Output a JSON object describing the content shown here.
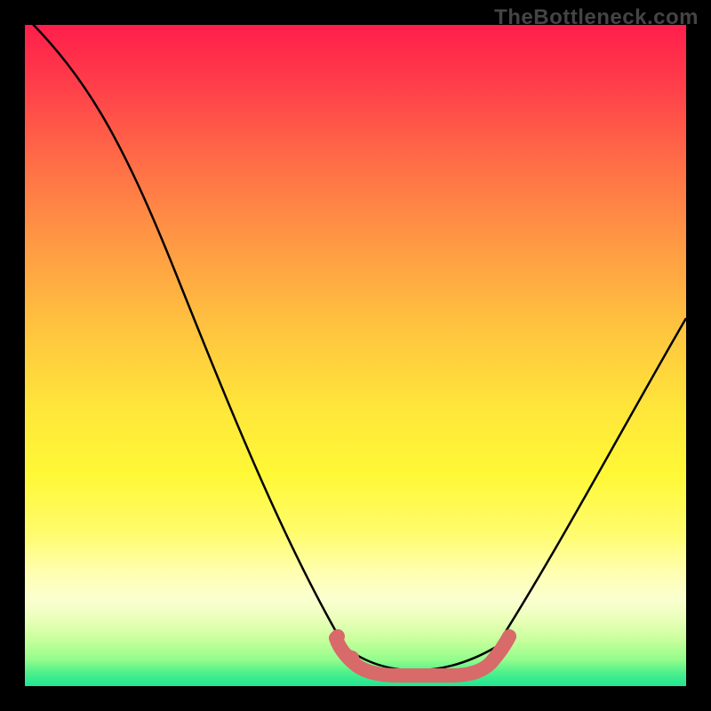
{
  "watermark": "TheBottleneck.com",
  "chart_data": {
    "type": "line",
    "title": "",
    "xlabel": "",
    "ylabel": "",
    "xlim": [
      0,
      100
    ],
    "ylim": [
      0,
      100
    ],
    "series": [
      {
        "name": "bottleneck-curve",
        "x": [
          0,
          5,
          10,
          15,
          20,
          25,
          30,
          35,
          40,
          45,
          50,
          55,
          60,
          65,
          70,
          75,
          80,
          85,
          90,
          95,
          100
        ],
        "values": [
          102,
          99,
          94,
          85,
          75,
          63,
          50,
          37,
          24,
          12,
          4,
          1,
          0,
          1,
          3,
          8,
          16,
          27,
          38,
          48,
          56
        ]
      },
      {
        "name": "optimal-zone-band",
        "x": [
          47,
          49,
          51,
          55,
          60,
          64,
          68,
          71,
          73
        ],
        "values": [
          8,
          5,
          2,
          1,
          1,
          1,
          2,
          5,
          8
        ]
      }
    ],
    "background_gradient_stops": [
      {
        "pos": 0.0,
        "color": "#ff1e4b"
      },
      {
        "pos": 0.2,
        "color": "#ff6a47"
      },
      {
        "pos": 0.46,
        "color": "#ffc43f"
      },
      {
        "pos": 0.68,
        "color": "#fff836"
      },
      {
        "pos": 0.87,
        "color": "#faffd0"
      },
      {
        "pos": 0.96,
        "color": "#94fd8c"
      },
      {
        "pos": 1.0,
        "color": "#1fe592"
      }
    ],
    "curve_color": "#000000",
    "band_color": "#d86a6a"
  }
}
